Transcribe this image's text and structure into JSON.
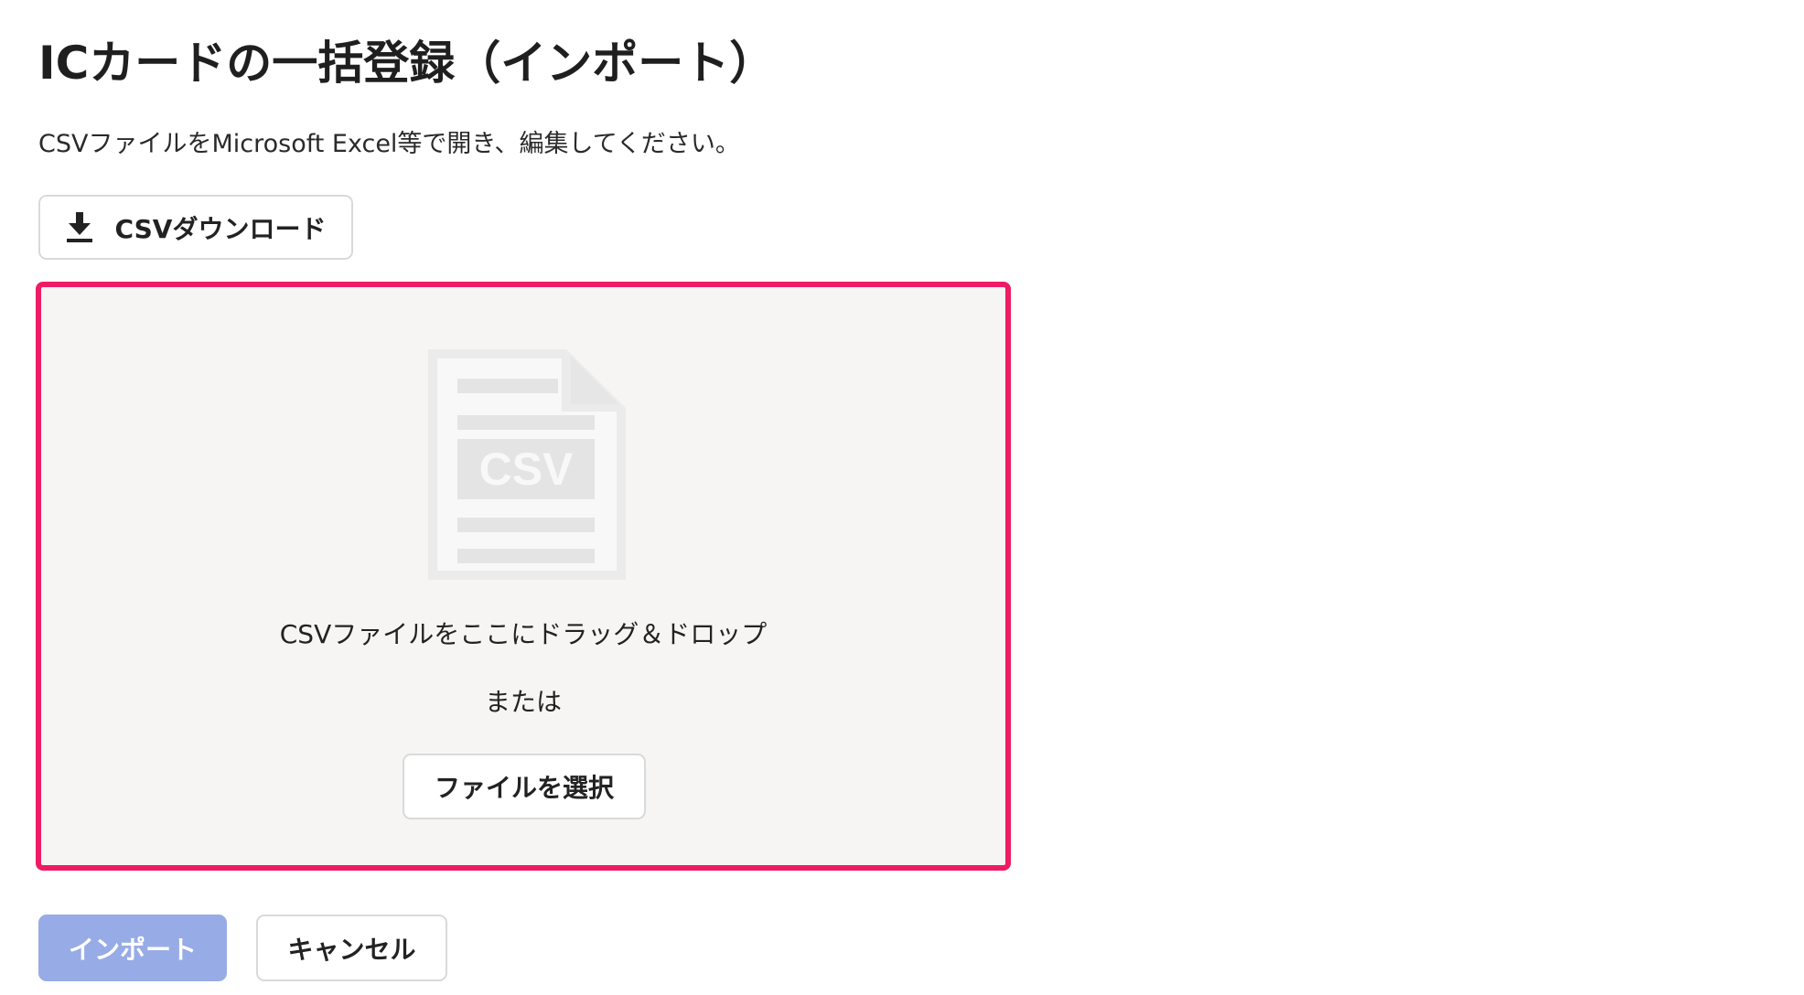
{
  "page": {
    "title": "ICカードの一括登録（インポート）",
    "description": "CSVファイルをMicrosoft Excel等で開き、編集してください。"
  },
  "download": {
    "label": "CSVダウンロード",
    "icon": "download-icon"
  },
  "dropzone": {
    "icon": "csv-file-icon",
    "icon_text": "CSV",
    "instruction": "CSVファイルをここにドラッグ＆ドロップ",
    "or_text": "または",
    "select_label": "ファイルを選択",
    "border_color": "#ee1c64",
    "background_color": "#f6f5f3"
  },
  "actions": {
    "import_label": "インポート",
    "import_disabled": true,
    "import_color": "#97abe6",
    "cancel_label": "キャンセル"
  }
}
